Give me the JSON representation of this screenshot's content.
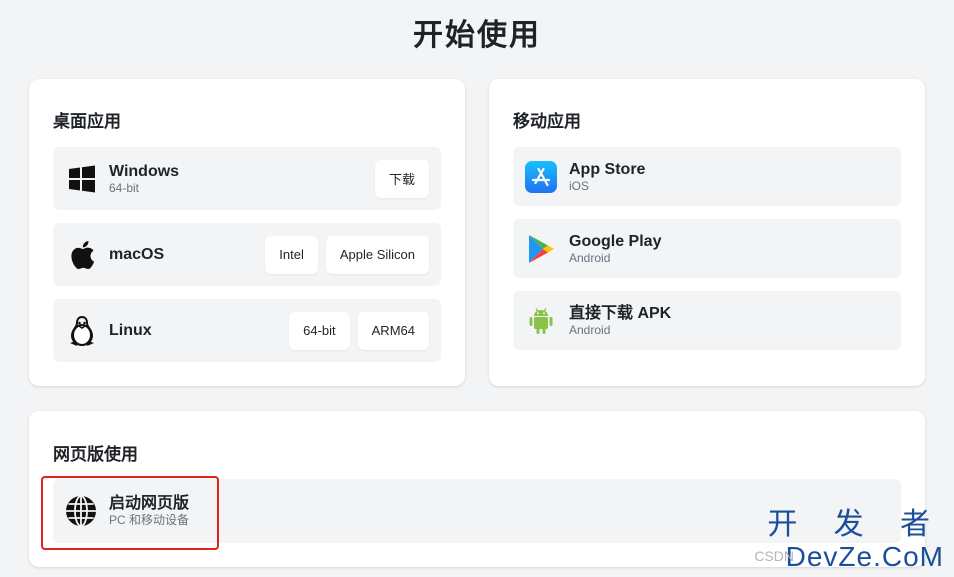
{
  "page": {
    "title": "开始使用"
  },
  "desktop": {
    "title": "桌面应用",
    "items": [
      {
        "name": "Windows",
        "sub": "64-bit",
        "icon": "windows-icon",
        "buttons": [
          "下载"
        ]
      },
      {
        "name": "macOS",
        "sub": "",
        "icon": "apple-icon",
        "buttons": [
          "Intel",
          "Apple Silicon"
        ]
      },
      {
        "name": "Linux",
        "sub": "",
        "icon": "linux-icon",
        "buttons": [
          "64-bit",
          "ARM64"
        ]
      }
    ]
  },
  "mobile": {
    "title": "移动应用",
    "items": [
      {
        "name": "App Store",
        "sub": "iOS",
        "icon": "app-store-icon"
      },
      {
        "name": "Google Play",
        "sub": "Android",
        "icon": "google-play-icon"
      },
      {
        "name": "直接下载 APK",
        "sub": "Android",
        "icon": "android-icon"
      }
    ]
  },
  "web": {
    "title": "网页版使用",
    "item": {
      "name": "启动网页版",
      "sub": "PC 和移动设备",
      "icon": "globe-icon"
    }
  },
  "watermark": {
    "top": "开 发 者",
    "bottom": "DevZe.CoM",
    "prefix": "CSDN"
  },
  "colors": {
    "accent_highlight": "#e0221b",
    "row_bg": "#f3f4f6",
    "card_bg": "#ffffff",
    "page_bg": "#f3f4f6"
  }
}
